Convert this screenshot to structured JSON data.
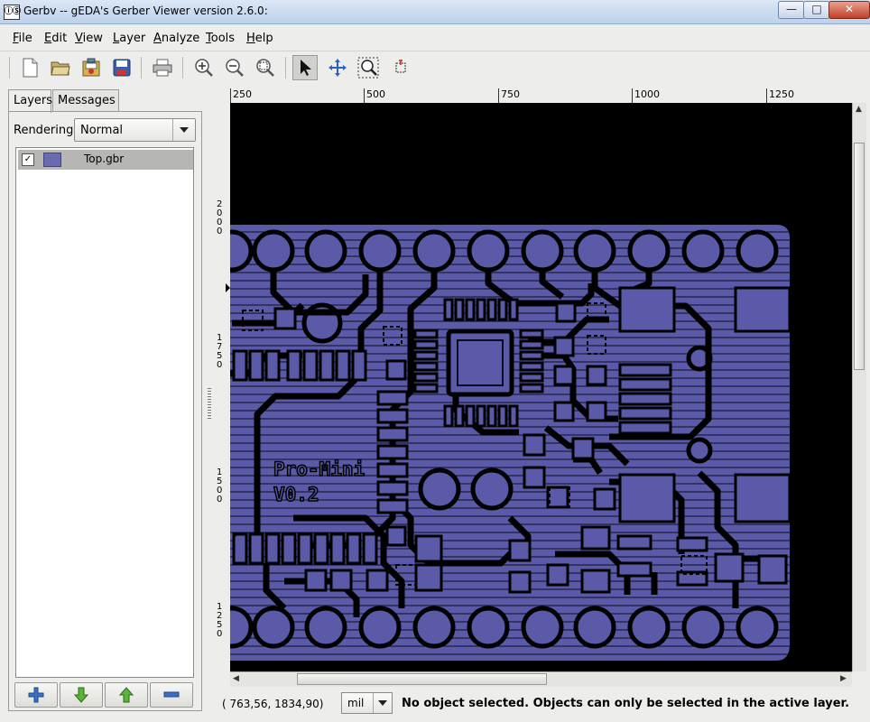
{
  "window": {
    "title": "Gerbv -- gEDA's Gerber Viewer version 2.6.0:",
    "app_icon_text": "ⓘⓈ",
    "buttons": [
      "minimize",
      "maximize",
      "close"
    ]
  },
  "menubar": {
    "items": [
      {
        "label": "File",
        "mnemonic": "F",
        "rest": "ile"
      },
      {
        "label": "Edit",
        "mnemonic": "E",
        "rest": "dit"
      },
      {
        "label": "View",
        "mnemonic": "V",
        "rest": "iew"
      },
      {
        "label": "Layer",
        "mnemonic": "L",
        "rest": "ayer"
      },
      {
        "label": "Analyze",
        "mnemonic": "A",
        "rest": "nalyze"
      },
      {
        "label": "Tools",
        "mnemonic": "T",
        "rest": "ools"
      },
      {
        "label": "Help",
        "mnemonic": "H",
        "rest": "elp"
      }
    ]
  },
  "toolbar": {
    "buttons": [
      "new-icon",
      "open-icon",
      "revert-icon",
      "save-icon",
      "print-icon",
      "zoom-in-icon",
      "zoom-out-icon",
      "zoom-fit-icon",
      "pointer-tool-icon",
      "pan-tool-icon",
      "zoom-tool-icon",
      "measure-tool-icon"
    ],
    "active_tool": "pointer-tool-icon"
  },
  "sidebar": {
    "tabs": [
      {
        "label": "Layers",
        "selected": true
      },
      {
        "label": "Messages",
        "selected": false
      }
    ],
    "rendering_label": "Rendering:",
    "rendering_value": "Normal",
    "layers": [
      {
        "name": "Top.gbr",
        "visible": true,
        "checkmark": "✓",
        "color": "#6a6ab4"
      }
    ],
    "bottom_buttons": [
      "add-layer-icon",
      "move-layer-down-icon",
      "move-layer-up-icon",
      "remove-layer-icon"
    ]
  },
  "ruler": {
    "h_labels": [
      "250",
      "500",
      "750",
      "1000",
      "1250"
    ],
    "v_labels": [
      "2000",
      "1750",
      "1500",
      "1250"
    ]
  },
  "board": {
    "fill_color": "#5a5aa8",
    "text_line1": "Pro-Mini",
    "text_line2": "V0.2"
  },
  "statusbar": {
    "coords": "( 763,56,  1834,90)",
    "unit": "mil",
    "message": "No object selected. Objects can only be selected in the active layer."
  }
}
